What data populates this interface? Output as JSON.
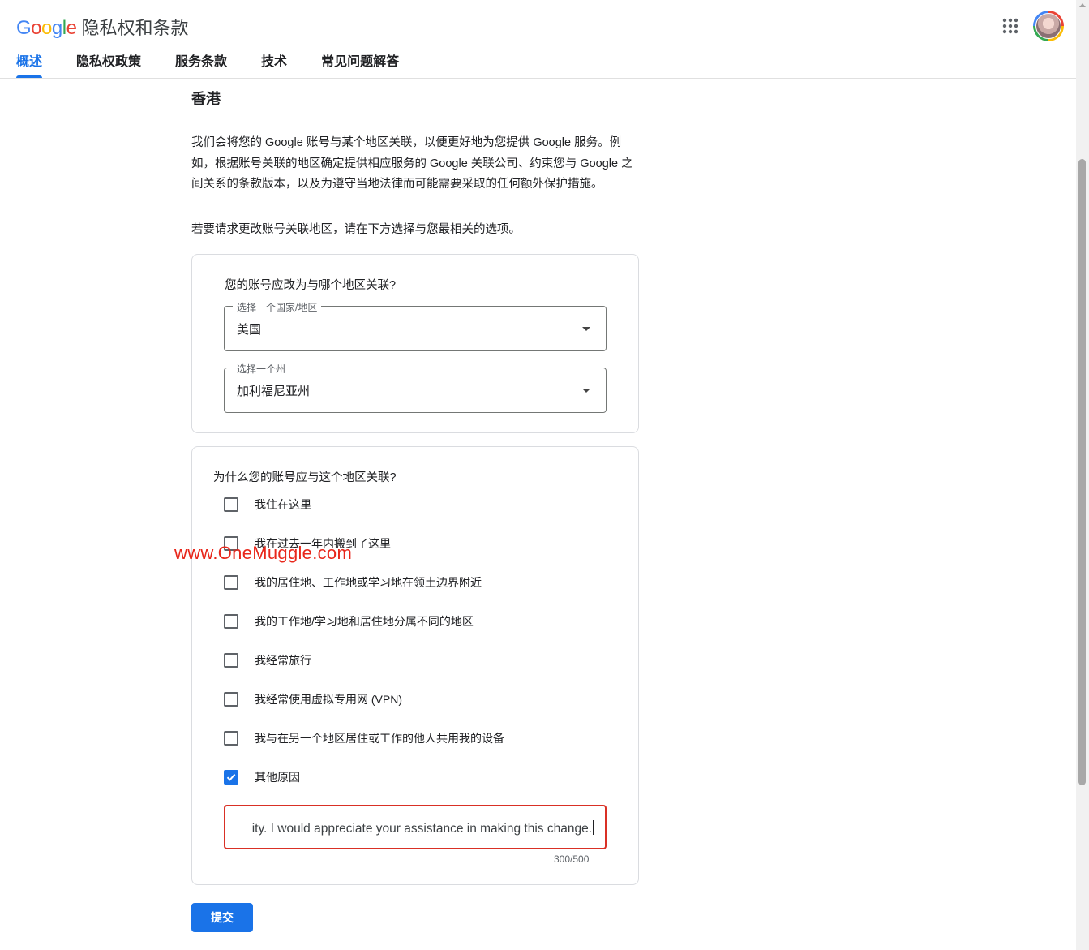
{
  "header": {
    "logo_letters": [
      {
        "char": "G",
        "color": "#4285f4"
      },
      {
        "char": "o",
        "color": "#ea4335"
      },
      {
        "char": "o",
        "color": "#fbbc05"
      },
      {
        "char": "g",
        "color": "#4285f4"
      },
      {
        "char": "l",
        "color": "#34a853"
      },
      {
        "char": "e",
        "color": "#ea4335"
      }
    ],
    "product_name": "隐私权和条款",
    "tabs": [
      {
        "label": "概述",
        "active": true
      },
      {
        "label": "隐私权政策",
        "active": false
      },
      {
        "label": "服务条款",
        "active": false
      },
      {
        "label": "技术",
        "active": false
      },
      {
        "label": "常见问题解答",
        "active": false
      }
    ],
    "apps_icon": "apps-grid-icon",
    "avatar_icon": "avatar"
  },
  "content": {
    "region_title": "香港",
    "paragraph_1": "我们会将您的 Google 账号与某个地区关联，以便更好地为您提供 Google 服务。例如，根据账号关联的地区确定提供相应服务的 Google 关联公司、约束您与 Google 之间关系的条款版本，以及为遵守当地法律而可能需要采取的任何额外保护措施。",
    "paragraph_2": "若要请求更改账号关联地区，请在下方选择与您最相关的选项。",
    "region_card": {
      "question": "您的账号应改为与哪个地区关联?",
      "country_select": {
        "label": "选择一个国家/地区",
        "value": "美国"
      },
      "state_select": {
        "label": "选择一个州",
        "value": "加利福尼亚州"
      }
    },
    "reason_card": {
      "question": "为什么您的账号应与这个地区关联?",
      "options": [
        {
          "label": "我住在这里",
          "checked": false
        },
        {
          "label": "我在过去一年内搬到了这里",
          "checked": false
        },
        {
          "label": "我的居住地、工作地或学习地在领土边界附近",
          "checked": false
        },
        {
          "label": "我的工作地/学习地和居住地分属不同的地区",
          "checked": false
        },
        {
          "label": "我经常旅行",
          "checked": false
        },
        {
          "label": "我经常使用虚拟专用网 (VPN)",
          "checked": false
        },
        {
          "label": "我与在另一个地区居住或工作的他人共用我的设备",
          "checked": false
        },
        {
          "label": "其他原因",
          "checked": true
        }
      ],
      "other_reason_text": "ity. I would appreciate your assistance in making this change.",
      "counter": "300/500"
    },
    "submit_label": "提交"
  },
  "watermark": "www.OneMuggle.com",
  "colors": {
    "accent": "#1a73e8",
    "error": "#d93025"
  }
}
